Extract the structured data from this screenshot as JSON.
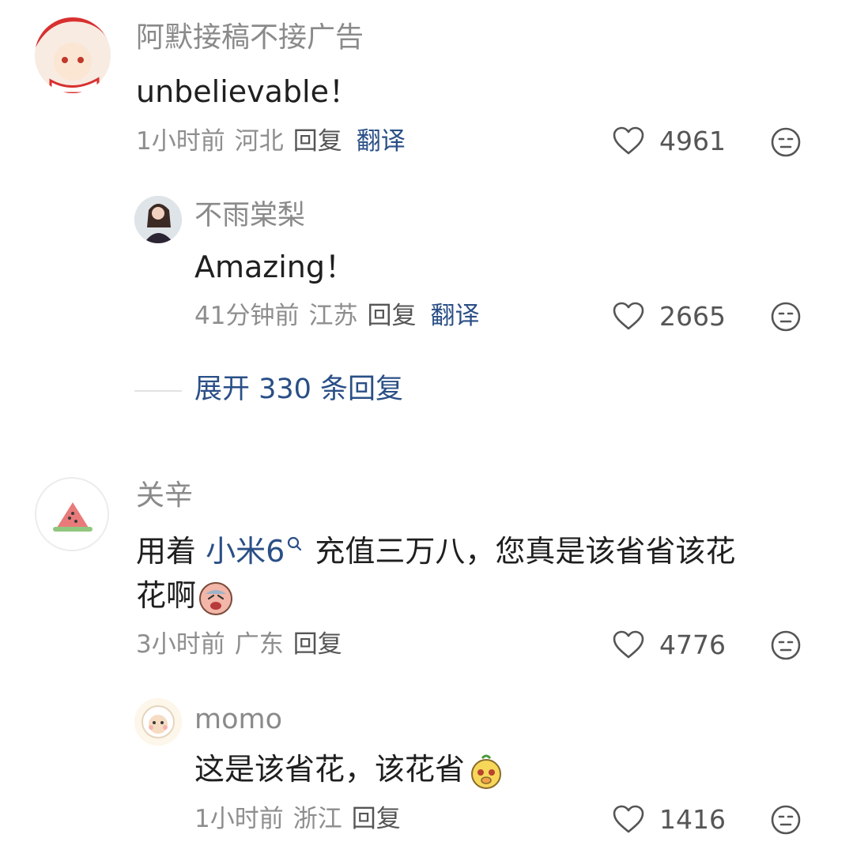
{
  "comments": [
    {
      "user": "阿默接稿不接广告",
      "text": "unbelievable！",
      "time": "1小时前",
      "location": "河北",
      "reply_label": "回复",
      "translate_label": "翻译",
      "likes": "4961",
      "replies": [
        {
          "user": "不雨棠梨",
          "text": "Amazing！",
          "time": "41分钟前",
          "location": "江苏",
          "reply_label": "回复",
          "translate_label": "翻译",
          "likes": "2665"
        }
      ],
      "expand_label": "展开 330 条回复"
    },
    {
      "user": "关辛",
      "text_before": "用着 ",
      "link_text": "小米6",
      "text_after_line1": " 充值三万八，您真是该省省该花",
      "text_line2": "花啊",
      "time": "3小时前",
      "location": "广东",
      "reply_label": "回复",
      "likes": "4776",
      "replies": [
        {
          "user": "momo",
          "text": "这是该省花，该花省",
          "time": "1小时前",
          "location": "浙江",
          "reply_label": "回复",
          "likes": "1416"
        }
      ]
    }
  ],
  "colors": {
    "accent": "#2a4f86",
    "muted": "#8e8e8e"
  }
}
